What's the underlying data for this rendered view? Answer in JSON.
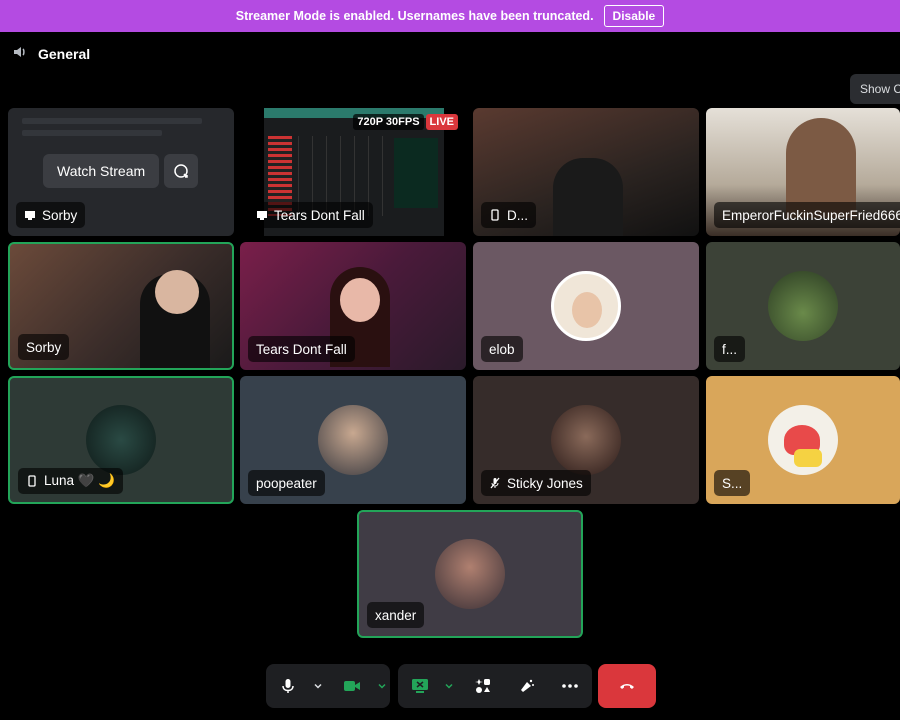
{
  "banner": {
    "text": "Streamer Mode is enabled. Usernames have been truncated.",
    "disable_label": "Disable"
  },
  "channel": {
    "name": "General"
  },
  "show_button": {
    "label": "Show C"
  },
  "stream_preview": {
    "watch_label": "Watch Stream",
    "quality": "720P 30FPS",
    "live": "LIVE"
  },
  "tiles": [
    {
      "name": "Sorby",
      "icon": "screen-share-icon"
    },
    {
      "name": "Tears Dont Fall",
      "icon": "screen-share-icon"
    },
    {
      "name": "D...",
      "icon": "mobile-icon"
    },
    {
      "name": "EmperorFuckinSuperFried666",
      "icon": ""
    },
    {
      "name": "Sorby",
      "icon": ""
    },
    {
      "name": "Tears Dont Fall",
      "icon": ""
    },
    {
      "name": "elob",
      "icon": ""
    },
    {
      "name": "f...",
      "icon": ""
    },
    {
      "name": "Luna 🖤 🌙",
      "icon": "mobile-icon"
    },
    {
      "name": "poopeater",
      "icon": ""
    },
    {
      "name": "Sticky Jones",
      "icon": "muted-mic-icon"
    },
    {
      "name": "S...",
      "icon": ""
    },
    {
      "name": "xander",
      "icon": ""
    }
  ],
  "colors": {
    "accent": "#b44be2",
    "speaking": "#23a559",
    "hangup": "#da373c",
    "green": "#23a559"
  },
  "controls": [
    "microphone-icon",
    "chevron-down-icon",
    "camera-icon",
    "chevron-down-icon",
    "screen-share-icon",
    "chevron-down-icon",
    "activities-icon",
    "soundboard-icon",
    "more-icon",
    "hangup-icon"
  ]
}
